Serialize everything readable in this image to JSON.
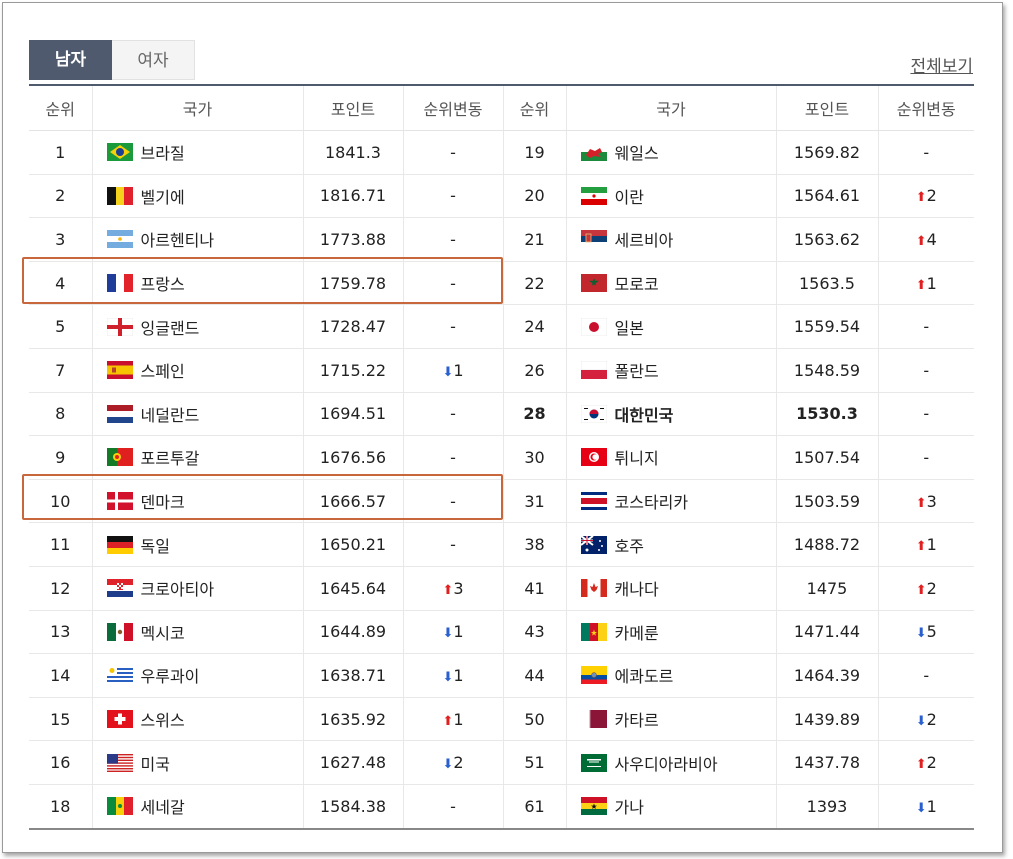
{
  "tabs": {
    "men": "남자",
    "women": "여자"
  },
  "view_all": "전체보기",
  "headers": {
    "rank": "순위",
    "country": "국가",
    "points": "포인트",
    "change": "순위변동"
  },
  "colors": {
    "tab_active": "#4f5a6f",
    "highlight": "#c8663c",
    "up": "#e02020",
    "down": "#2a5fd0"
  },
  "rows": [
    {
      "left": {
        "rank": "1",
        "country": "브라질",
        "flag": "brazil-flag",
        "points": "1841.3",
        "dir": "",
        "chg": "-"
      },
      "right": {
        "rank": "19",
        "country": "웨일스",
        "flag": "wales-flag",
        "points": "1569.82",
        "dir": "",
        "chg": "-"
      }
    },
    {
      "left": {
        "rank": "2",
        "country": "벨기에",
        "flag": "belgium-flag",
        "points": "1816.71",
        "dir": "",
        "chg": "-"
      },
      "right": {
        "rank": "20",
        "country": "이란",
        "flag": "iran-flag",
        "points": "1564.61",
        "dir": "up",
        "chg": "2"
      }
    },
    {
      "left": {
        "rank": "3",
        "country": "아르헨티나",
        "flag": "argentina-flag",
        "points": "1773.88",
        "dir": "",
        "chg": "-"
      },
      "right": {
        "rank": "21",
        "country": "세르비아",
        "flag": "serbia-flag",
        "points": "1563.62",
        "dir": "up",
        "chg": "4"
      }
    },
    {
      "left": {
        "rank": "4",
        "country": "프랑스",
        "flag": "france-flag",
        "points": "1759.78",
        "dir": "",
        "chg": "-"
      },
      "right": {
        "rank": "22",
        "country": "모로코",
        "flag": "morocco-flag",
        "points": "1563.5",
        "dir": "up",
        "chg": "1"
      }
    },
    {
      "left": {
        "rank": "5",
        "country": "잉글랜드",
        "flag": "england-flag",
        "points": "1728.47",
        "dir": "",
        "chg": "-"
      },
      "right": {
        "rank": "24",
        "country": "일본",
        "flag": "japan-flag",
        "points": "1559.54",
        "dir": "",
        "chg": "-"
      }
    },
    {
      "left": {
        "rank": "7",
        "country": "스페인",
        "flag": "spain-flag",
        "points": "1715.22",
        "dir": "down",
        "chg": "1"
      },
      "right": {
        "rank": "26",
        "country": "폴란드",
        "flag": "poland-flag",
        "points": "1548.59",
        "dir": "",
        "chg": "-"
      }
    },
    {
      "left": {
        "rank": "8",
        "country": "네덜란드",
        "flag": "netherlands-flag",
        "points": "1694.51",
        "dir": "",
        "chg": "-"
      },
      "right": {
        "rank": "28",
        "country": "대한민국",
        "flag": "korea-flag",
        "points": "1530.3",
        "dir": "",
        "chg": "-",
        "bold": true
      }
    },
    {
      "left": {
        "rank": "9",
        "country": "포르투갈",
        "flag": "portugal-flag",
        "points": "1676.56",
        "dir": "",
        "chg": "-"
      },
      "right": {
        "rank": "30",
        "country": "튀니지",
        "flag": "tunisia-flag",
        "points": "1507.54",
        "dir": "",
        "chg": "-"
      }
    },
    {
      "left": {
        "rank": "10",
        "country": "덴마크",
        "flag": "denmark-flag",
        "points": "1666.57",
        "dir": "",
        "chg": "-"
      },
      "right": {
        "rank": "31",
        "country": "코스타리카",
        "flag": "costa-rica-flag",
        "points": "1503.59",
        "dir": "up",
        "chg": "3"
      }
    },
    {
      "left": {
        "rank": "11",
        "country": "독일",
        "flag": "germany-flag",
        "points": "1650.21",
        "dir": "",
        "chg": "-"
      },
      "right": {
        "rank": "38",
        "country": "호주",
        "flag": "australia-flag",
        "points": "1488.72",
        "dir": "up",
        "chg": "1"
      }
    },
    {
      "left": {
        "rank": "12",
        "country": "크로아티아",
        "flag": "croatia-flag",
        "points": "1645.64",
        "dir": "up",
        "chg": "3"
      },
      "right": {
        "rank": "41",
        "country": "캐나다",
        "flag": "canada-flag",
        "points": "1475",
        "dir": "up",
        "chg": "2"
      }
    },
    {
      "left": {
        "rank": "13",
        "country": "멕시코",
        "flag": "mexico-flag",
        "points": "1644.89",
        "dir": "down",
        "chg": "1"
      },
      "right": {
        "rank": "43",
        "country": "카메룬",
        "flag": "cameroon-flag",
        "points": "1471.44",
        "dir": "down",
        "chg": "5"
      }
    },
    {
      "left": {
        "rank": "14",
        "country": "우루과이",
        "flag": "uruguay-flag",
        "points": "1638.71",
        "dir": "down",
        "chg": "1"
      },
      "right": {
        "rank": "44",
        "country": "에콰도르",
        "flag": "ecuador-flag",
        "points": "1464.39",
        "dir": "",
        "chg": "-"
      }
    },
    {
      "left": {
        "rank": "15",
        "country": "스위스",
        "flag": "switzerland-flag",
        "points": "1635.92",
        "dir": "up",
        "chg": "1"
      },
      "right": {
        "rank": "50",
        "country": "카타르",
        "flag": "qatar-flag",
        "points": "1439.89",
        "dir": "down",
        "chg": "2"
      }
    },
    {
      "left": {
        "rank": "16",
        "country": "미국",
        "flag": "usa-flag",
        "points": "1627.48",
        "dir": "down",
        "chg": "2"
      },
      "right": {
        "rank": "51",
        "country": "사우디아라비아",
        "flag": "saudi-arabia-flag",
        "points": "1437.78",
        "dir": "up",
        "chg": "2"
      }
    },
    {
      "left": {
        "rank": "18",
        "country": "세네갈",
        "flag": "senegal-flag",
        "points": "1584.38",
        "dir": "",
        "chg": "-"
      },
      "right": {
        "rank": "61",
        "country": "가나",
        "flag": "ghana-flag",
        "points": "1393",
        "dir": "down",
        "chg": "1"
      }
    }
  ]
}
